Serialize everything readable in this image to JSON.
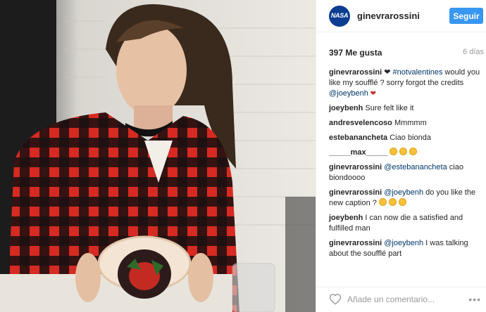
{
  "post": {
    "username": "ginevrarossini",
    "follow_label": "Seguir",
    "avatar_text": "NASA",
    "likes": "397 Me gusta",
    "time": "6 días"
  },
  "comments": [
    {
      "user": "ginevrarossini",
      "text_pre": " ❤ ",
      "hashtag": "#notvalentines",
      "text_mid": " would you like my soufflé ? sorry forgot the credits ",
      "mention": "@joeybenh",
      "text_post": " ❤"
    },
    {
      "user": "joeybenh",
      "text": "Sure felt like it"
    },
    {
      "user": "andresvelencoso",
      "text": "Mmmmm"
    },
    {
      "user": "estebanancheta",
      "text": "Ciao bionda"
    },
    {
      "user": "_____max_____",
      "text": ""
    },
    {
      "user": "ginevrarossini",
      "mention": "@estebanancheta",
      "text": " ciao biondoooo"
    },
    {
      "user": "ginevrarossini",
      "mention": "@joeybenh",
      "text": " do you like the new caption ?"
    },
    {
      "user": "joeybenh",
      "text": "I can now die a satisfied and fulfilled man"
    },
    {
      "user": "ginevrarossini",
      "mention": "@joeybenh",
      "text": " I was talking about the soufflé part"
    }
  ],
  "footer": {
    "comment_placeholder": "Añade un comentario..."
  },
  "colors": {
    "follow": "#3897f0",
    "link": "#003569",
    "shirt_red": "#c8201b"
  }
}
